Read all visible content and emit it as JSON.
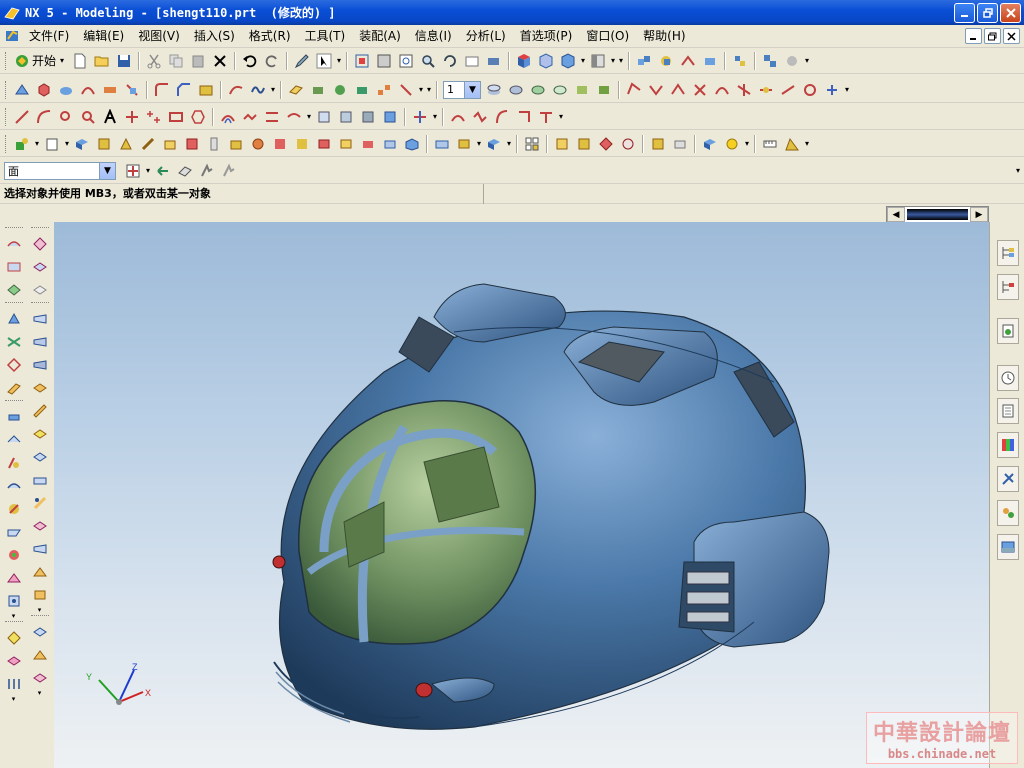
{
  "window": {
    "title": "NX 5 - Modeling - [shengt110.prt  (修改的) ]"
  },
  "menu": {
    "items": [
      "文件(F)",
      "编辑(E)",
      "视图(V)",
      "插入(S)",
      "格式(R)",
      "工具(T)",
      "装配(A)",
      "信息(I)",
      "分析(L)",
      "首选项(P)",
      "窗口(O)",
      "帮助(H)"
    ]
  },
  "toolbar1": {
    "start_label": "开始"
  },
  "toolbar2": {
    "layer_value": "1"
  },
  "selection": {
    "filter_value": "面"
  },
  "status": {
    "prompt": "选择对象并使用 MB3，或者双击某一对象"
  },
  "viewport": {
    "axis_x": "X",
    "axis_y": "Y",
    "axis_z": "Z"
  },
  "watermark": {
    "name": "中華設計論壇",
    "url": "bbs.chinade.net"
  },
  "colors": {
    "titlebar": "#0a4fd6",
    "model": "#4a78a8",
    "canopy": "#6e9060",
    "background_top": "#9dbad8",
    "background_bottom": "#eef1f3"
  }
}
